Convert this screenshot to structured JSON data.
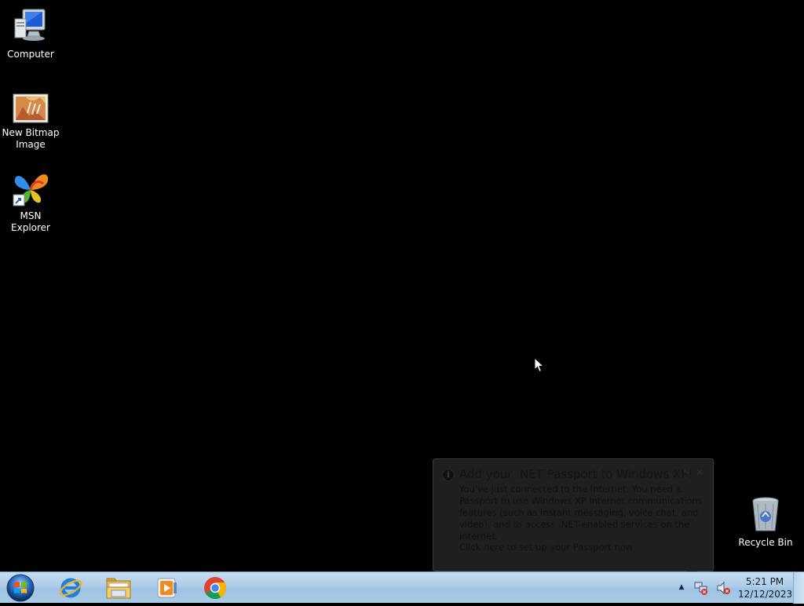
{
  "desktop": {
    "icons": [
      {
        "label": "Computer",
        "icon": "computer-icon"
      },
      {
        "label": "New Bitmap Image",
        "icon": "bitmap-image-icon"
      },
      {
        "label": "MSN Explorer",
        "icon": "msn-butterfly-icon"
      },
      {
        "label": "Recycle Bin",
        "icon": "recycle-bin-icon"
      }
    ]
  },
  "balloon": {
    "title": "Add your .NET Passport to Windows XP!",
    "body": "You've just connected to the Internet.  You need a Passport to use Windows XP Internet communications features (such as instant messaging, voice chat, and video), and to access .NET-enabled services on the Internet.",
    "link": "Click here to set up your Passport now",
    "info_icon": "info-icon",
    "options_icon": "pin-icon",
    "close_icon": "close-icon"
  },
  "taskbar": {
    "start_icon": "windows-start-orb",
    "pinned": [
      {
        "name": "Internet Explorer",
        "icon": "internet-explorer-icon"
      },
      {
        "name": "Windows Explorer",
        "icon": "folder-explorer-icon"
      },
      {
        "name": "Windows Media Player",
        "icon": "media-player-icon"
      },
      {
        "name": "Google Chrome",
        "icon": "chrome-icon"
      }
    ],
    "tray": {
      "show_hidden_icon": "chevron-up-icon",
      "network_icon": "network-error-icon",
      "volume_icon": "speaker-muted-icon"
    },
    "clock": {
      "time": "5:21 PM",
      "date": "12/12/2023"
    }
  },
  "colors": {
    "desktop_background": "#000000",
    "taskbar_top": "#c6ddef",
    "taskbar_bottom": "#a9cbe7"
  }
}
